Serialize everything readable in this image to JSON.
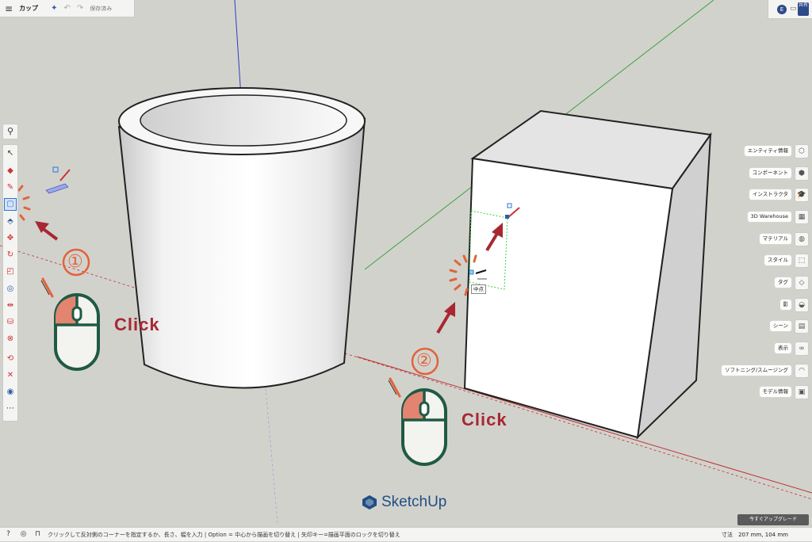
{
  "app": {
    "title": "カップ",
    "saved_status": "保存済み",
    "icons": {
      "menu": "hamburger-icon",
      "sparkle": "sparkle-icon",
      "undo": "undo-icon",
      "redo": "redo-icon"
    }
  },
  "topright": {
    "avatar_letter": "E",
    "share_label": "共有"
  },
  "tools": [
    {
      "name": "select-tool",
      "glyph": "↖"
    },
    {
      "name": "eraser-tool",
      "glyph": "◆"
    },
    {
      "name": "pencil-tool",
      "glyph": "✎"
    },
    {
      "name": "rectangle-tool",
      "glyph": "▢"
    },
    {
      "name": "pushpull-tool",
      "glyph": "⬘"
    },
    {
      "name": "move-tool",
      "glyph": "✥"
    },
    {
      "name": "rotate-tool",
      "glyph": "↻"
    },
    {
      "name": "scale-tool",
      "glyph": "◰"
    },
    {
      "name": "offset-tool",
      "glyph": "◎"
    },
    {
      "name": "tapemeasure-tool",
      "glyph": "⇹"
    },
    {
      "name": "paint-tool",
      "glyph": "⛁"
    },
    {
      "name": "section-tool",
      "glyph": "⊗"
    },
    {
      "name": "orbit-tool",
      "glyph": "⟲"
    },
    {
      "name": "zoomextent-tool",
      "glyph": "✕"
    },
    {
      "name": "walk-tool",
      "glyph": "◉"
    },
    {
      "name": "more-tools",
      "glyph": "⋯"
    }
  ],
  "right_panel": [
    {
      "label": "エンティティ情報",
      "icon": "entity-info-icon",
      "glyph": "⬡"
    },
    {
      "label": "コンポーネント",
      "icon": "components-icon",
      "glyph": "⬢"
    },
    {
      "label": "インストラクタ",
      "icon": "instructor-icon",
      "glyph": "🎓"
    },
    {
      "label": "3D Warehouse",
      "icon": "warehouse-icon",
      "glyph": "▦"
    },
    {
      "label": "マテリアル",
      "icon": "materials-icon",
      "glyph": "◍"
    },
    {
      "label": "スタイル",
      "icon": "styles-icon",
      "glyph": "⬚"
    },
    {
      "label": "タグ",
      "icon": "tags-icon",
      "glyph": "◇"
    },
    {
      "label": "影",
      "icon": "shadows-icon",
      "glyph": "◒"
    },
    {
      "label": "シーン",
      "icon": "scenes-icon",
      "glyph": "▤"
    },
    {
      "label": "表示",
      "icon": "display-icon",
      "glyph": "∞"
    },
    {
      "label": "ソフトニング/スムージング",
      "icon": "soften-icon",
      "glyph": "◠"
    },
    {
      "label": "モデル情報",
      "icon": "model-info-icon",
      "glyph": "▣"
    }
  ],
  "canvas": {
    "tooltip": "中点",
    "steps": [
      "①",
      "②"
    ],
    "click_label": "Click"
  },
  "brand": "SketchUp",
  "status": {
    "hint": "クリックして反対側のコーナーを指定するか、長さ、幅を入力 | Option = 中心から描画を切り替え | 矢印キー=描画平面のロックを切り替え",
    "measure_label": "寸法",
    "measure_value": "207 mm, 104 mm",
    "upgrade_label": "今すぐアップグレード"
  },
  "colors": {
    "accent": "#a72832",
    "burst": "#e0643a",
    "mouse_green": "#1f5a44",
    "mouse_fill": "#e28470",
    "brand": "#1f4e84",
    "selection_green": "#3ad13a"
  }
}
